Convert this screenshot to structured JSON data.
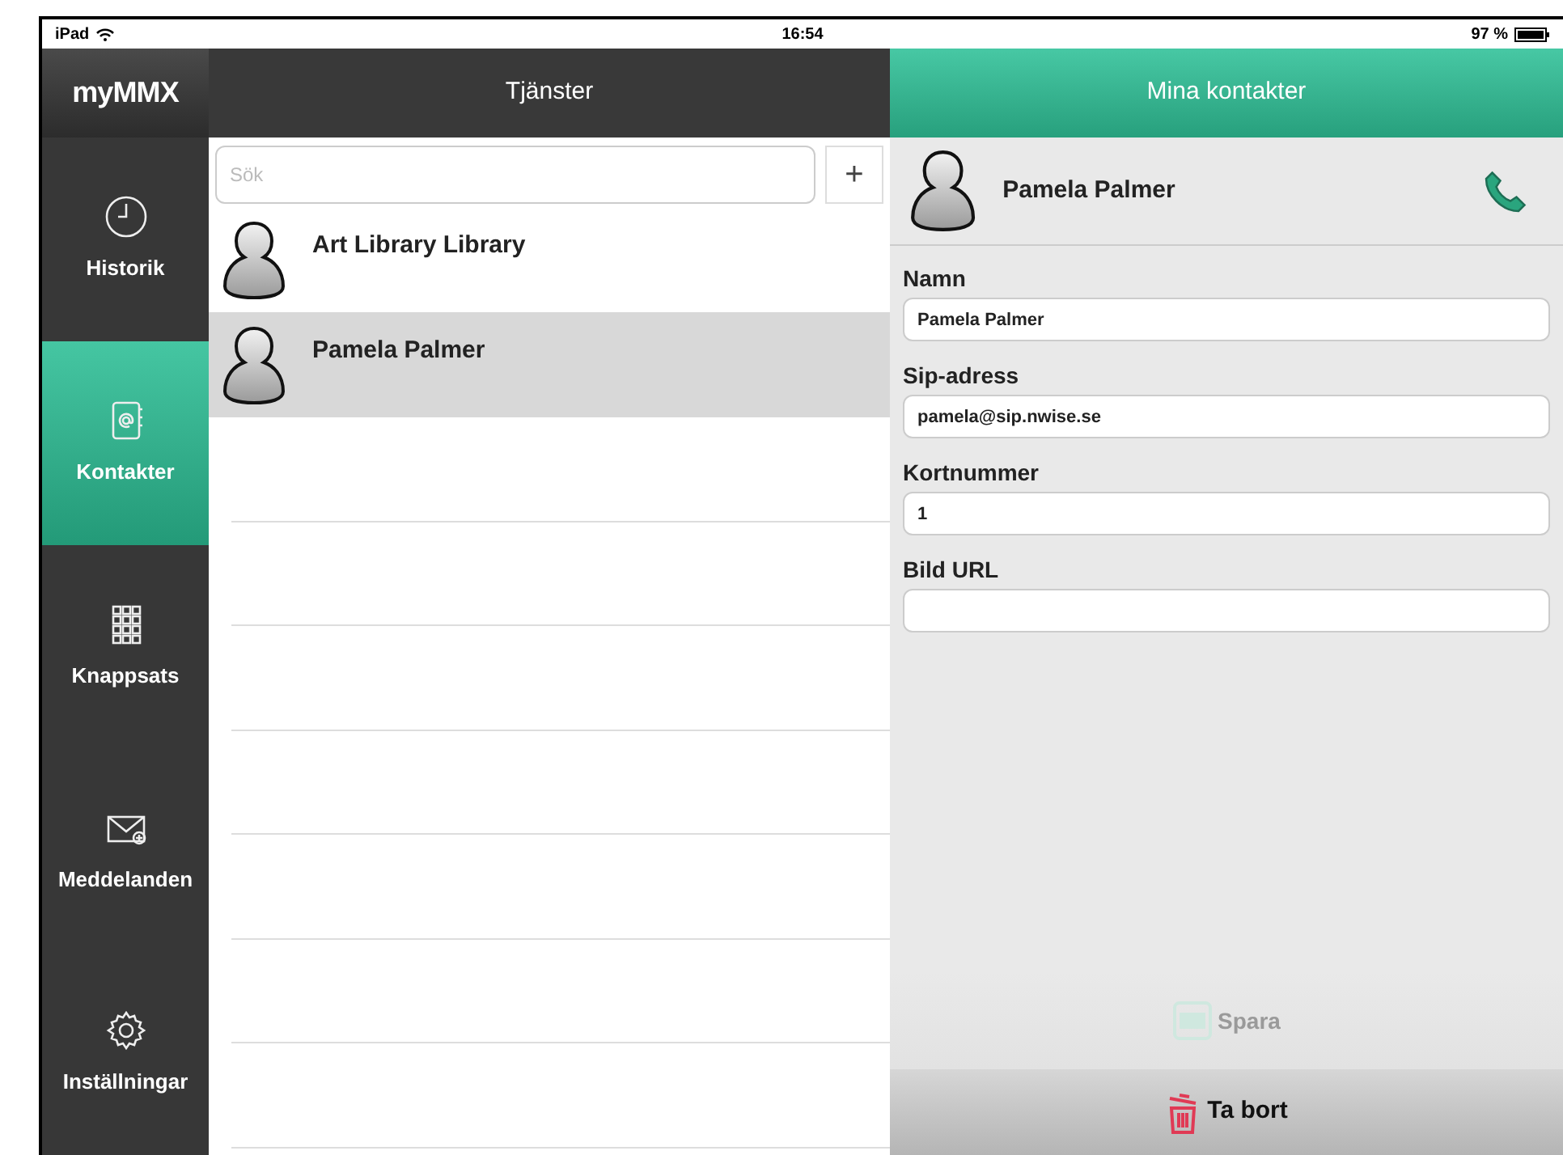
{
  "status_bar": {
    "device": "iPad",
    "time": "16:54",
    "battery": "97 %"
  },
  "logo": "myMMX",
  "sidebar": {
    "items": [
      {
        "label": "Historik",
        "kind": "clock",
        "selected": false
      },
      {
        "label": "Kontakter",
        "kind": "contacts",
        "selected": true
      },
      {
        "label": "Knappsats",
        "kind": "keypad",
        "selected": false
      },
      {
        "label": "Meddelanden",
        "kind": "mail",
        "selected": false
      },
      {
        "label": "Inställningar",
        "kind": "gear",
        "selected": false
      }
    ]
  },
  "list": {
    "title": "Tjänster",
    "search": {
      "placeholder": "Sök"
    },
    "add_button": "+",
    "contacts": [
      {
        "name": "Art Library Library",
        "selected": false
      },
      {
        "name": "Pamela Palmer",
        "selected": true
      }
    ]
  },
  "detail": {
    "title": "Mina kontakter",
    "contact_name": "Pamela Palmer",
    "fields": [
      {
        "label": "Namn",
        "value": "Pamela Palmer"
      },
      {
        "label": "Sip-adress",
        "value": "pamela@sip.nwise.se"
      },
      {
        "label": "Kortnummer",
        "value": "1"
      },
      {
        "label": "Bild URL"
      }
    ],
    "save_button": {
      "label": "Spara",
      "disabled": true
    },
    "delete_button": {
      "label": "Ta bort"
    }
  }
}
